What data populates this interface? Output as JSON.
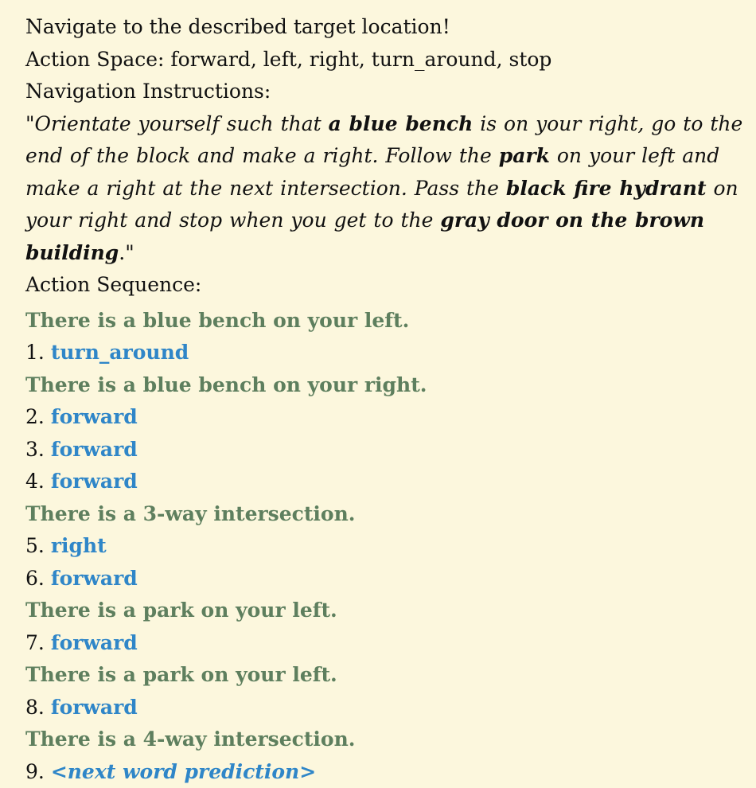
{
  "intro": "Navigate to the described target location!",
  "action_space": "Action Space: forward, left, right, turn_around, stop",
  "instructions_heading": "Navigation Instructions:",
  "instruction": {
    "open_quote": "\"",
    "close_quote": ".\"",
    "p1": "Orientate yourself such that ",
    "b1": "a blue bench",
    "p2": " is on your right, go to the end of the block and make a right. Follow the ",
    "b2": "park",
    "p3": " on your left and make a right at the next intersection. Pass the ",
    "b3": "black fire hydrant",
    "p4": " on your right and stop when you get to the ",
    "b4": "gray door on the brown building"
  },
  "sequence_heading": "Action Sequence:",
  "sequence": [
    {
      "kind": "obs",
      "text": "There is a blue bench on your left."
    },
    {
      "kind": "act",
      "num": "1.",
      "text": "turn_around"
    },
    {
      "kind": "obs",
      "text": "There is a blue bench on your right."
    },
    {
      "kind": "act",
      "num": "2.",
      "text": "forward"
    },
    {
      "kind": "act",
      "num": "3.",
      "text": "forward"
    },
    {
      "kind": "act",
      "num": "4.",
      "text": "forward"
    },
    {
      "kind": "obs",
      "text": "There is a 3-way intersection."
    },
    {
      "kind": "act",
      "num": "5.",
      "text": "right"
    },
    {
      "kind": "act",
      "num": "6.",
      "text": "forward"
    },
    {
      "kind": "obs",
      "text": "There is a park on your left."
    },
    {
      "kind": "act",
      "num": "7.",
      "text": "forward"
    },
    {
      "kind": "obs",
      "text": "There is a park on your left."
    },
    {
      "kind": "act",
      "num": "8.",
      "text": "forward"
    },
    {
      "kind": "obs",
      "text": "There is a 4-way intersection."
    },
    {
      "kind": "act",
      "num": "9.",
      "text": "<next word prediction>"
    }
  ],
  "colors": {
    "background": "#fcf7dd",
    "observation": "#5e7f5e",
    "action": "#2f86c8",
    "text": "#111111"
  }
}
